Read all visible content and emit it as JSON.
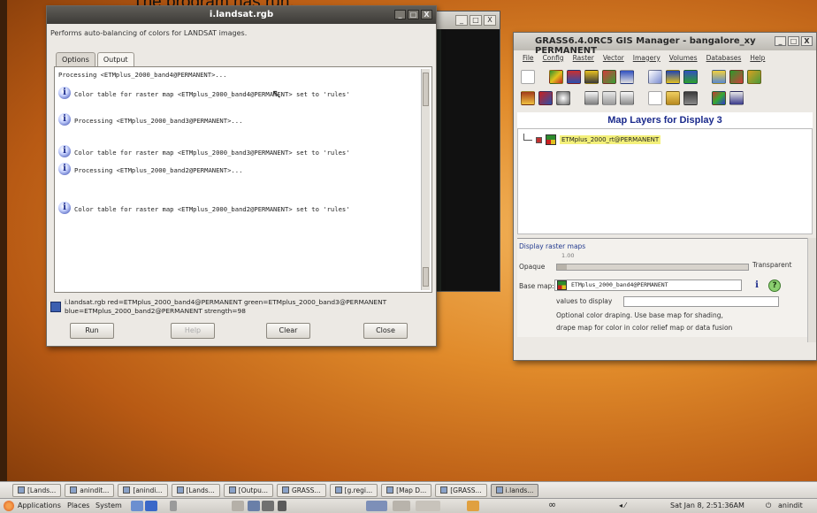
{
  "caption": "The program has run.",
  "landsat_window": {
    "title": "i.landsat.rgb",
    "description": "Performs auto-balancing of colors for LANDSAT images.",
    "tabs": [
      "Options",
      "Output"
    ],
    "output_lines": [
      "Processing <ETMplus_2000_band4@PERMANENT>...",
      "Color table for raster map <ETMplus_2000_band4@PERMANENT> set to 'rules'",
      "Processing <ETMplus_2000_band3@PERMANENT>...",
      "Color table for raster map <ETMplus_2000_band3@PERMANENT> set to 'rules'",
      "Processing <ETMplus_2000_band2@PERMANENT>...",
      "Color table for raster map <ETMplus_2000_band2@PERMANENT> set to 'rules'"
    ],
    "command": "i.landsat.rgb red=ETMplus_2000_band4@PERMANENT green=ETMplus_2000_band3@PERMANENT blue=ETMplus_2000_band2@PERMANENT strength=98",
    "buttons": {
      "run": "Run",
      "help": "Help",
      "clear": "Clear",
      "close": "Close"
    },
    "window_controls": [
      "_",
      "□",
      "X"
    ]
  },
  "terminal_window": {
    "controls": [
      "_",
      "□",
      "X"
    ]
  },
  "grass_window": {
    "title": "GRASS6.4.0RC5 GIS Manager - bangalore_xy PERMANENT",
    "controls": [
      "_",
      "□",
      "X"
    ],
    "menu": [
      "File",
      "Config",
      "Raster",
      "Vector",
      "Imagery",
      "Volumes",
      "Databases",
      "Help"
    ],
    "layers_title": "Map Layers for Display 3",
    "layer_name": "ETMplus_2000_rt@PERMANENT",
    "options": {
      "heading": "Display raster maps",
      "opaque_label": "Opaque",
      "opacity_value": "1.00",
      "opacity_level": 0.05,
      "transparent_label": "Transparent",
      "base_map_label": "Base map:",
      "base_map_value": "ETMplus_2000_band4@PERMANENT",
      "info_glyph": "i",
      "help_glyph": "?",
      "values_label": "values to display",
      "note_line1": "Optional color draping. Use base map for shading,",
      "note_line2": "drape map for color in color relief map or data fusion"
    }
  },
  "taskbar": {
    "tasks": [
      "[Lands...",
      "anindit...",
      "[anindi...",
      "[Lands...",
      "[Outpu...",
      "GRASS...",
      "[g.regi...",
      "[Map D...",
      "[GRASS...",
      "i.lands..."
    ]
  },
  "panel": {
    "menus": [
      "Applications",
      "Places",
      "System"
    ],
    "clock": "Sat Jan 8, 2:51:36AM",
    "user": "anindit"
  }
}
